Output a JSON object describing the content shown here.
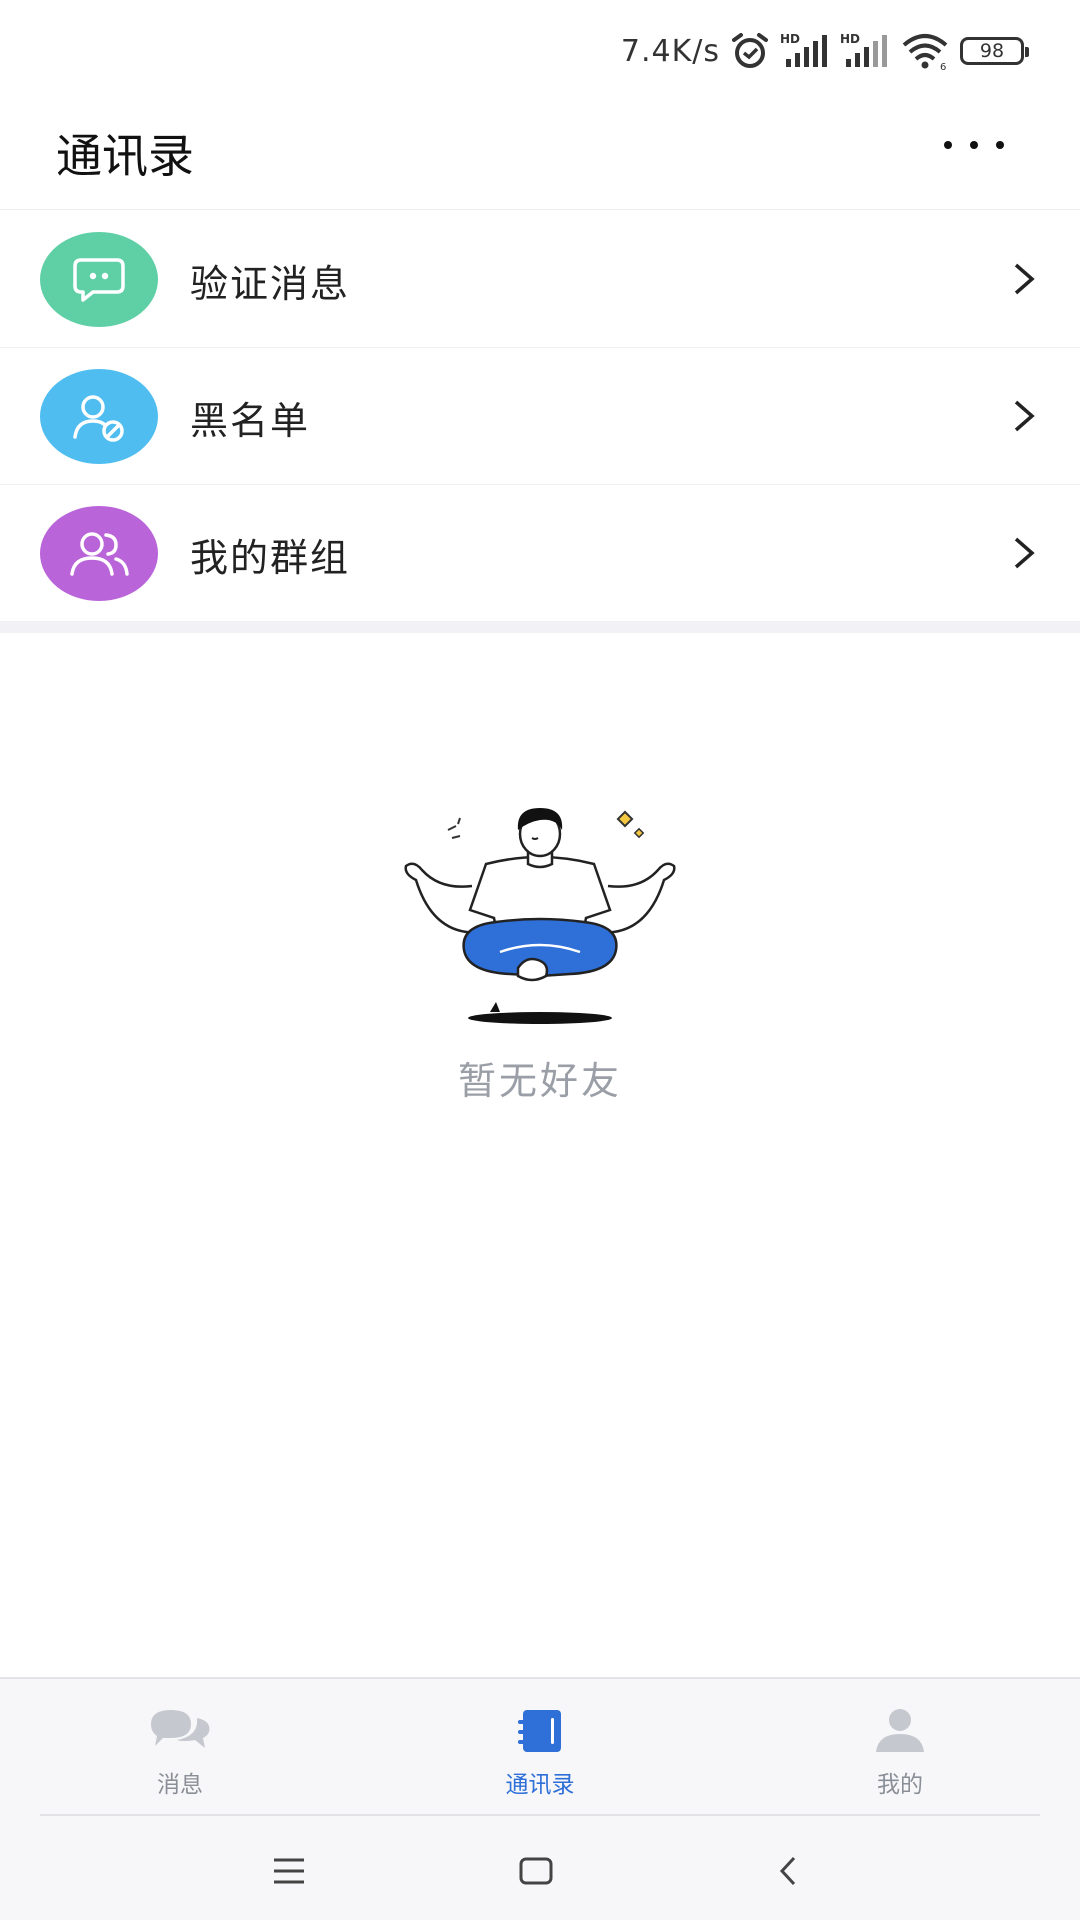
{
  "status_bar": {
    "net_speed": "7.4K/s",
    "icons": [
      "alarm-icon",
      "signal-hd-icon",
      "signal-hd-icon",
      "wifi-icon"
    ],
    "battery": "98"
  },
  "header": {
    "title": "通讯录",
    "more_icon": "more-icon"
  },
  "entries": [
    {
      "label": "验证消息",
      "icon": "chat-bubble-icon",
      "color": "#5fcfa6"
    },
    {
      "label": "黑名单",
      "icon": "user-block-icon",
      "color": "#4fbdf0"
    },
    {
      "label": "我的群组",
      "icon": "group-icon",
      "color": "#b964d9"
    }
  ],
  "empty_state": {
    "text": "暂无好友"
  },
  "tabs": [
    {
      "label": "消息",
      "icon": "messages-icon",
      "active": false
    },
    {
      "label": "通讯录",
      "icon": "contacts-book-icon",
      "active": true
    },
    {
      "label": "我的",
      "icon": "profile-icon",
      "active": false
    }
  ],
  "colors": {
    "accent": "#2f6fd8",
    "inactive_tab": "#8a8f97",
    "empty_text": "#9a9ea6"
  },
  "nav_bar": {
    "buttons": [
      "menu-icon",
      "home-icon",
      "back-icon"
    ]
  }
}
